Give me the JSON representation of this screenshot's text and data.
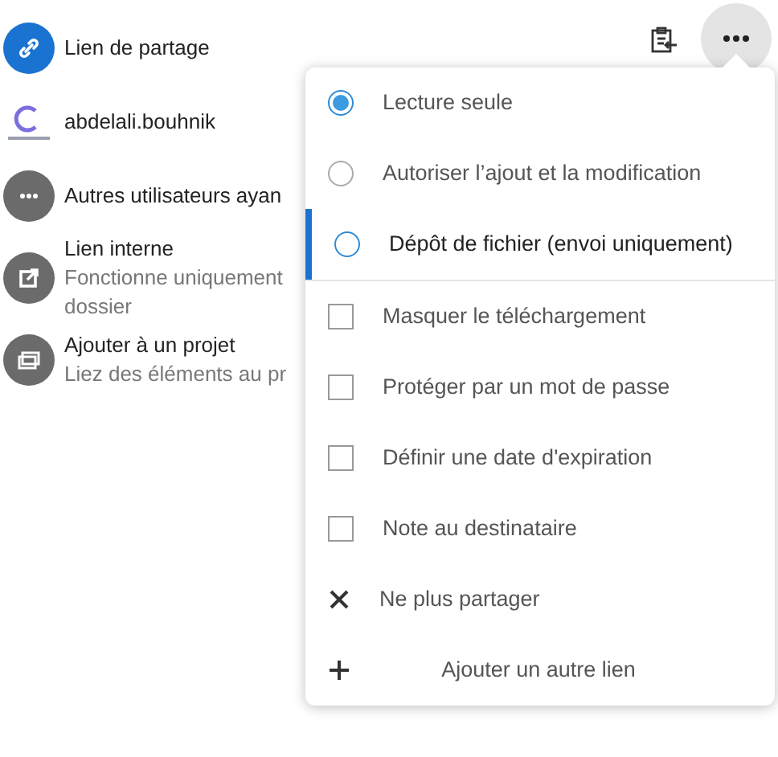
{
  "entries": [
    {
      "kind": "link",
      "title": "Lien de partage"
    },
    {
      "kind": "user",
      "title": "abdelali.bouhnik"
    },
    {
      "kind": "others",
      "title": "Autres utilisateurs ayan"
    },
    {
      "kind": "internal",
      "title": "Lien interne",
      "subtitle": "Fonctionne uniquement",
      "subtitle_2": "dossier"
    },
    {
      "kind": "project",
      "title": "Ajouter à un projet",
      "subtitle": "Liez des éléments au pr"
    }
  ],
  "menu": {
    "items": [
      {
        "kind": "radio",
        "label": "Lecture seule",
        "selected": true,
        "highlighted": false
      },
      {
        "kind": "radio",
        "label": "Autoriser l’ajout et la modification",
        "selected": false,
        "highlighted": false
      },
      {
        "kind": "radio",
        "label": "Dépôt de fichier (envoi uniquement)",
        "selected": false,
        "highlighted": true
      },
      {
        "kind": "checkbox",
        "label": "Masquer le téléchargement",
        "checked": false
      },
      {
        "kind": "checkbox",
        "label": "Protéger par un mot de passe",
        "checked": false
      },
      {
        "kind": "checkbox",
        "label": "Définir une date d'expiration",
        "checked": false
      },
      {
        "kind": "checkbox",
        "label": "Note au destinataire",
        "checked": false
      },
      {
        "kind": "unshare",
        "label": "Ne plus partager"
      },
      {
        "kind": "add",
        "label": "Ajouter un autre lien"
      }
    ]
  }
}
